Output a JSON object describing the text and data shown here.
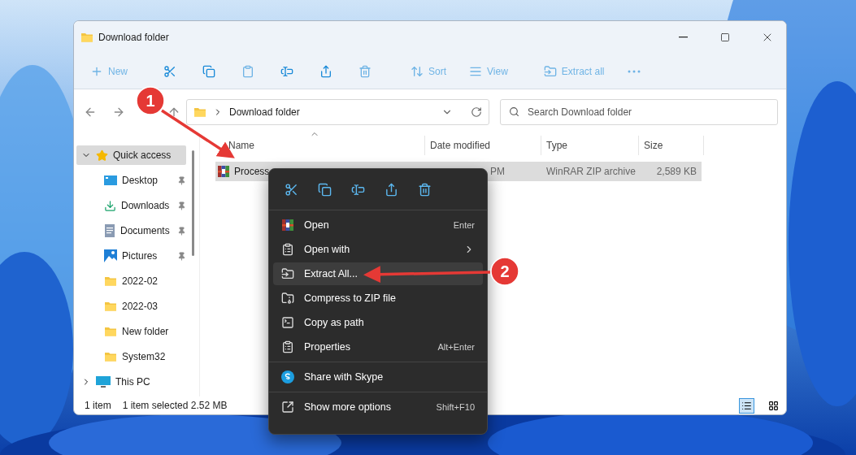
{
  "window": {
    "title": "Download folder"
  },
  "toolbar": [
    {
      "label": "New",
      "disabled": true
    },
    {
      "disabled": false
    },
    {
      "disabled": false
    },
    {
      "disabled": true
    },
    {
      "disabled": false
    },
    {
      "disabled": false
    },
    {
      "disabled": true
    },
    {
      "label": "Sort",
      "disabled": true
    },
    {
      "label": "View",
      "disabled": true
    },
    {
      "label": "Extract all",
      "disabled": true
    },
    {
      "disabled": true
    }
  ],
  "address": {
    "path": "Download folder"
  },
  "search": {
    "placeholder": "Search Download folder"
  },
  "nav": [
    {
      "label": "Quick access",
      "kind": "star",
      "selected": true,
      "expanded": true,
      "children": [
        {
          "label": "Desktop",
          "kind": "desktop",
          "pinned": true
        },
        {
          "label": "Downloads",
          "kind": "download",
          "pinned": true
        },
        {
          "label": "Documents",
          "kind": "document",
          "pinned": true
        },
        {
          "label": "Pictures",
          "kind": "pictures",
          "pinned": true
        },
        {
          "label": "2022-02",
          "kind": "folder",
          "pinned": false
        },
        {
          "label": "2022-03",
          "kind": "folder",
          "pinned": false
        },
        {
          "label": "New folder",
          "kind": "folder",
          "pinned": false
        },
        {
          "label": "System32",
          "kind": "folder",
          "pinned": false
        }
      ]
    },
    {
      "label": "This PC",
      "kind": "pc",
      "selected": false,
      "expanded": false
    }
  ],
  "columns": [
    {
      "label": "Name",
      "sorted": true
    },
    {
      "label": "Date modified",
      "sorted": false
    },
    {
      "label": "Type",
      "sorted": false
    },
    {
      "label": "Size",
      "sorted": false
    }
  ],
  "rows": [
    {
      "name": "Process",
      "date": "PM",
      "type": "WinRAR ZIP archive",
      "size": "2,589 KB",
      "selected": true
    }
  ],
  "status_bar": {
    "count": "1 item",
    "selection": "1 item selected  2.52 MB",
    "views": [
      {
        "kind": "details",
        "selected": true
      },
      {
        "kind": "tiles",
        "selected": false
      }
    ]
  },
  "context_menu": {
    "groups": [
      {
        "items": [
          {
            "label": "Open",
            "kind": "archive",
            "shortcut": "Enter",
            "submenu": false,
            "selected": false
          },
          {
            "label": "Open with",
            "kind": "apps",
            "submenu": true,
            "selected": false
          },
          {
            "label": "Extract All...",
            "kind": "extract",
            "submenu": false,
            "selected": true
          },
          {
            "label": "Compress to ZIP file",
            "kind": "zip",
            "submenu": false,
            "selected": false
          },
          {
            "label": "Copy as path",
            "kind": "path",
            "submenu": false,
            "selected": false
          },
          {
            "label": "Properties",
            "kind": "properties",
            "shortcut": "Alt+Enter",
            "submenu": false,
            "selected": false
          }
        ]
      },
      {
        "items": [
          {
            "label": "Share with Skype",
            "kind": "skype",
            "submenu": false,
            "selected": false
          }
        ]
      },
      {
        "items": [
          {
            "label": "Show more options",
            "kind": "expand",
            "shortcut": "Shift+F10",
            "submenu": false,
            "selected": false
          }
        ]
      }
    ]
  },
  "annotations": [
    {
      "label": "1"
    },
    {
      "label": "2"
    }
  ]
}
